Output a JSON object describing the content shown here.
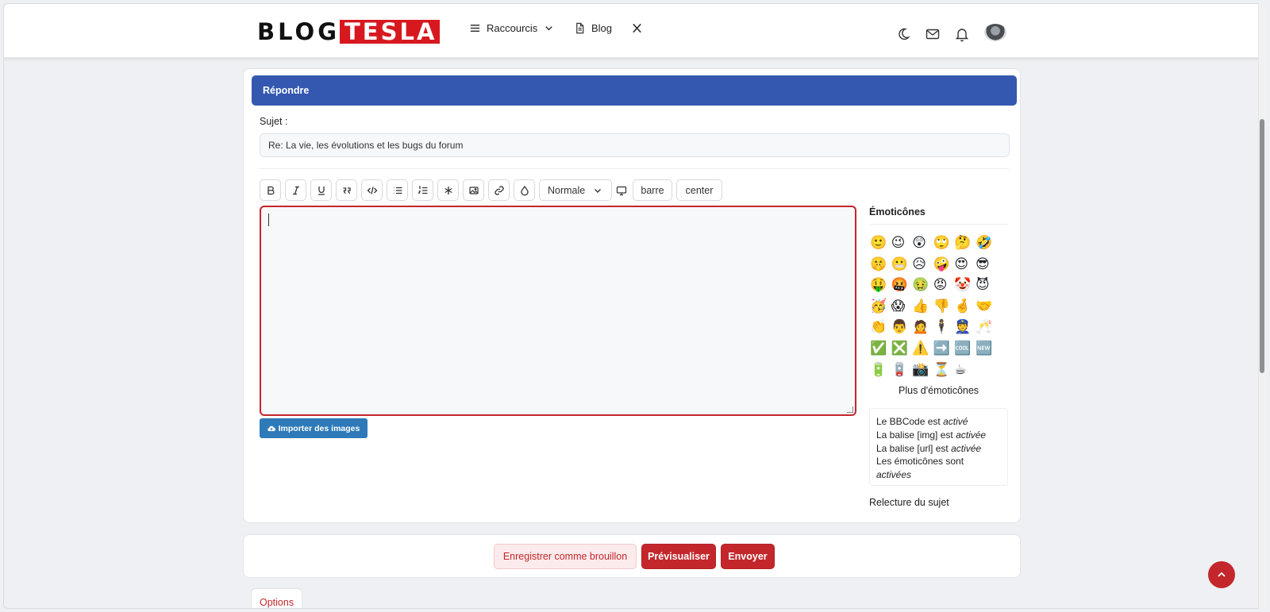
{
  "header": {
    "logo_left": "BLOG",
    "logo_right": "TESLA",
    "nav": [
      {
        "label": "Raccourcis",
        "icon": "menu-icon",
        "has_dropdown": true
      },
      {
        "label": "Blog",
        "icon": "document-icon"
      },
      {
        "label": "",
        "icon": "x-logo-icon"
      }
    ],
    "icons": [
      "moon-icon",
      "mail-icon",
      "bell-icon",
      "avatar"
    ]
  },
  "reply": {
    "title": "Répondre",
    "subject_label": "Sujet :",
    "subject_value": "Re: La vie, les évolutions et les bugs du forum",
    "toolbar": {
      "bold": "B",
      "italic": "I",
      "underline": "U",
      "size_select": "Normale",
      "barre": "barre",
      "center": "center"
    },
    "import_button": "Importer des images",
    "emoticons_title": "Émoticônes",
    "emoticons": [
      "🙂",
      "😉",
      "😲",
      "🙄",
      "🤔",
      "🤣",
      "🤫",
      "😬",
      "😥",
      "🤪",
      "😍",
      "😎",
      "🤑",
      "🤬",
      "🤢",
      "😡",
      "🤡",
      "😈",
      "🥳",
      "😱",
      "👍",
      "👎",
      "🤞",
      "🤝",
      "👏",
      "👨",
      "🙍",
      "🕴",
      "👮",
      "🥂",
      "✅",
      "❎",
      "⚠️",
      "➡️",
      "🆒",
      "🆕",
      "🔋",
      "🪫",
      "📸",
      "⏳",
      "☕"
    ],
    "more_emoticons": "Plus d'émoticônes",
    "bbcode": {
      "line1_prefix": "Le BBCode est ",
      "line1_state": "activé",
      "line2_prefix": "La balise [img] est ",
      "line2_state": "activée",
      "line3_prefix": "La balise [url] est ",
      "line3_state": "activée",
      "line4_prefix": "Les émoticônes sont ",
      "line4_state": "activées"
    },
    "topic_review": "Relecture du sujet"
  },
  "actions": {
    "draft": "Enregistrer comme brouillon",
    "preview": "Prévisualiser",
    "send": "Envoyer"
  },
  "tabs": {
    "options": "Options"
  },
  "colors": {
    "brand_red": "#c3272c",
    "header_blue": "#3458b0",
    "import_blue": "#2e7ab8"
  }
}
